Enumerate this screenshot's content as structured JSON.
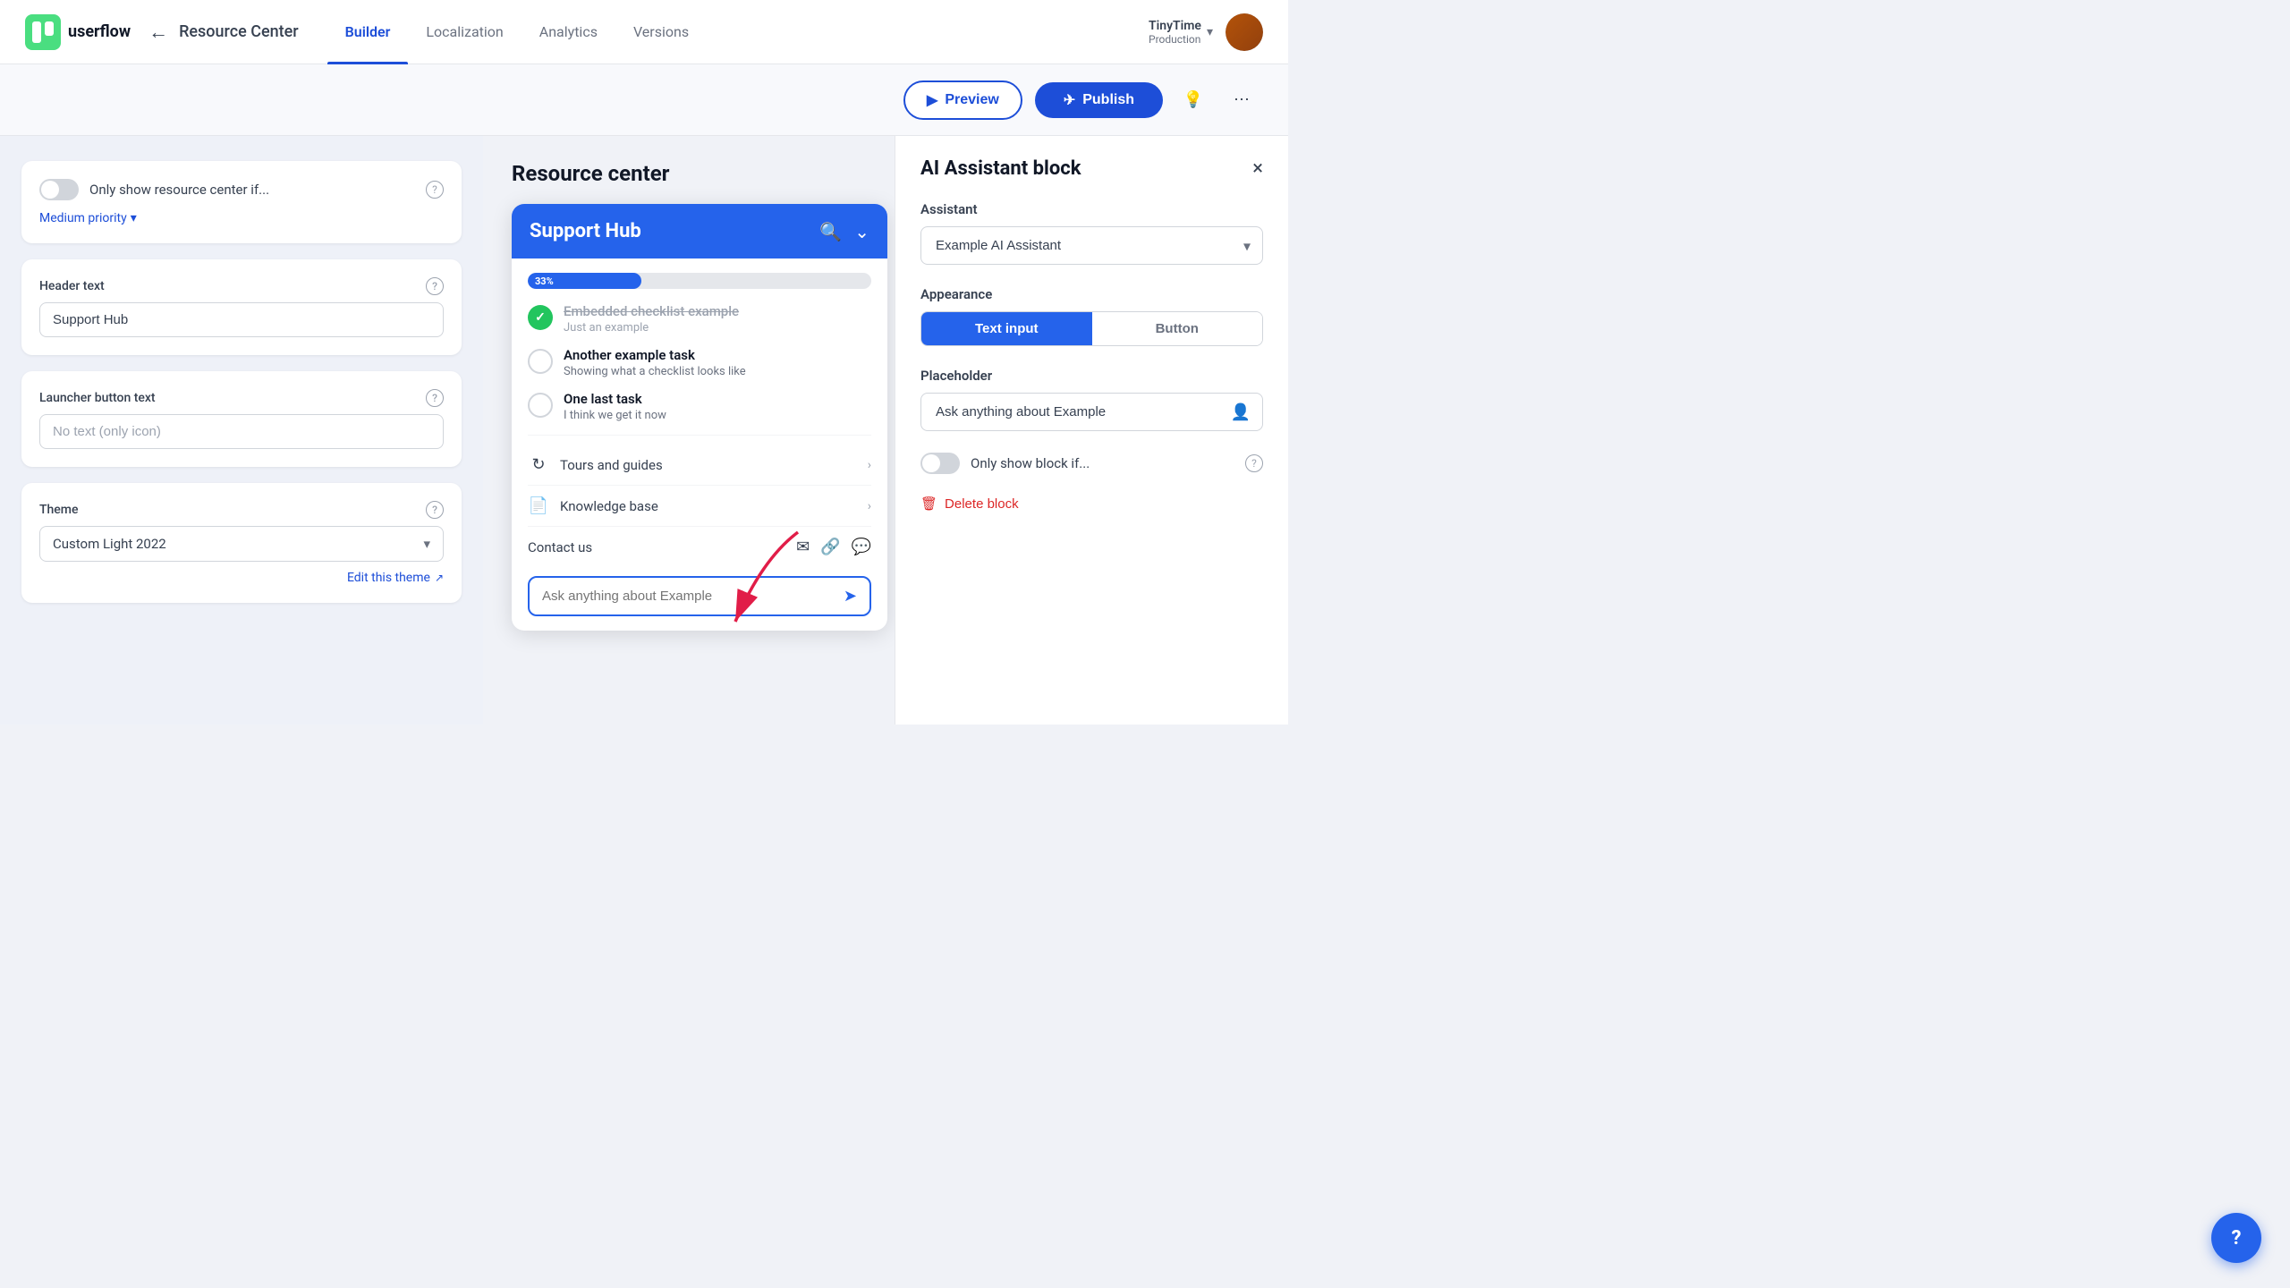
{
  "app": {
    "logo_text": "userflow",
    "back_label": "←",
    "page_title": "Resource Center",
    "tabs": [
      {
        "id": "builder",
        "label": "Builder",
        "active": true
      },
      {
        "id": "localization",
        "label": "Localization",
        "active": false
      },
      {
        "id": "analytics",
        "label": "Analytics",
        "active": false
      },
      {
        "id": "versions",
        "label": "Versions",
        "active": false
      }
    ],
    "user_name": "TinyTime",
    "user_sub": "Production",
    "toolbar": {
      "preview_label": "Preview",
      "publish_label": "Publish"
    }
  },
  "left_panel": {
    "toggle_label": "Only show resource center if...",
    "priority_label": "Medium priority",
    "header_text_label": "Header text",
    "header_text_value": "Support Hub",
    "launcher_label": "Launcher button text",
    "launcher_placeholder": "No text (only icon)",
    "theme_label": "Theme",
    "theme_value": "Custom Light 2022",
    "edit_theme_label": "Edit this theme"
  },
  "center_panel": {
    "title": "Resource center",
    "widget": {
      "header_title": "Support Hub",
      "progress_pct": 33,
      "progress_label": "33%",
      "checklist_items": [
        {
          "done": true,
          "main": "Embedded checklist example",
          "sub": "Just an example",
          "strikethrough": true
        },
        {
          "done": false,
          "main": "Another example task",
          "sub": "Showing what a checklist looks like",
          "strikethrough": false
        },
        {
          "done": false,
          "main": "One last task",
          "sub": "I think we get it now",
          "strikethrough": false
        }
      ],
      "menu_items": [
        {
          "label": "Tours and guides",
          "icon": "↻"
        },
        {
          "label": "Knowledge base",
          "icon": "📄"
        }
      ],
      "contact_label": "Contact us",
      "ai_placeholder": "Ask anything about Example",
      "send_icon": "➤"
    }
  },
  "right_panel": {
    "title": "AI Assistant block",
    "close_icon": "×",
    "assistant_label": "Assistant",
    "assistant_value": "Example AI Assistant",
    "appearance_label": "Appearance",
    "appearance_options": [
      {
        "label": "Text input",
        "active": true
      },
      {
        "label": "Button",
        "active": false
      }
    ],
    "placeholder_label": "Placeholder",
    "placeholder_value": "Ask anything about Example",
    "only_show_label": "Only show block if...",
    "delete_label": "Delete block"
  },
  "fab": {
    "label": "?"
  }
}
